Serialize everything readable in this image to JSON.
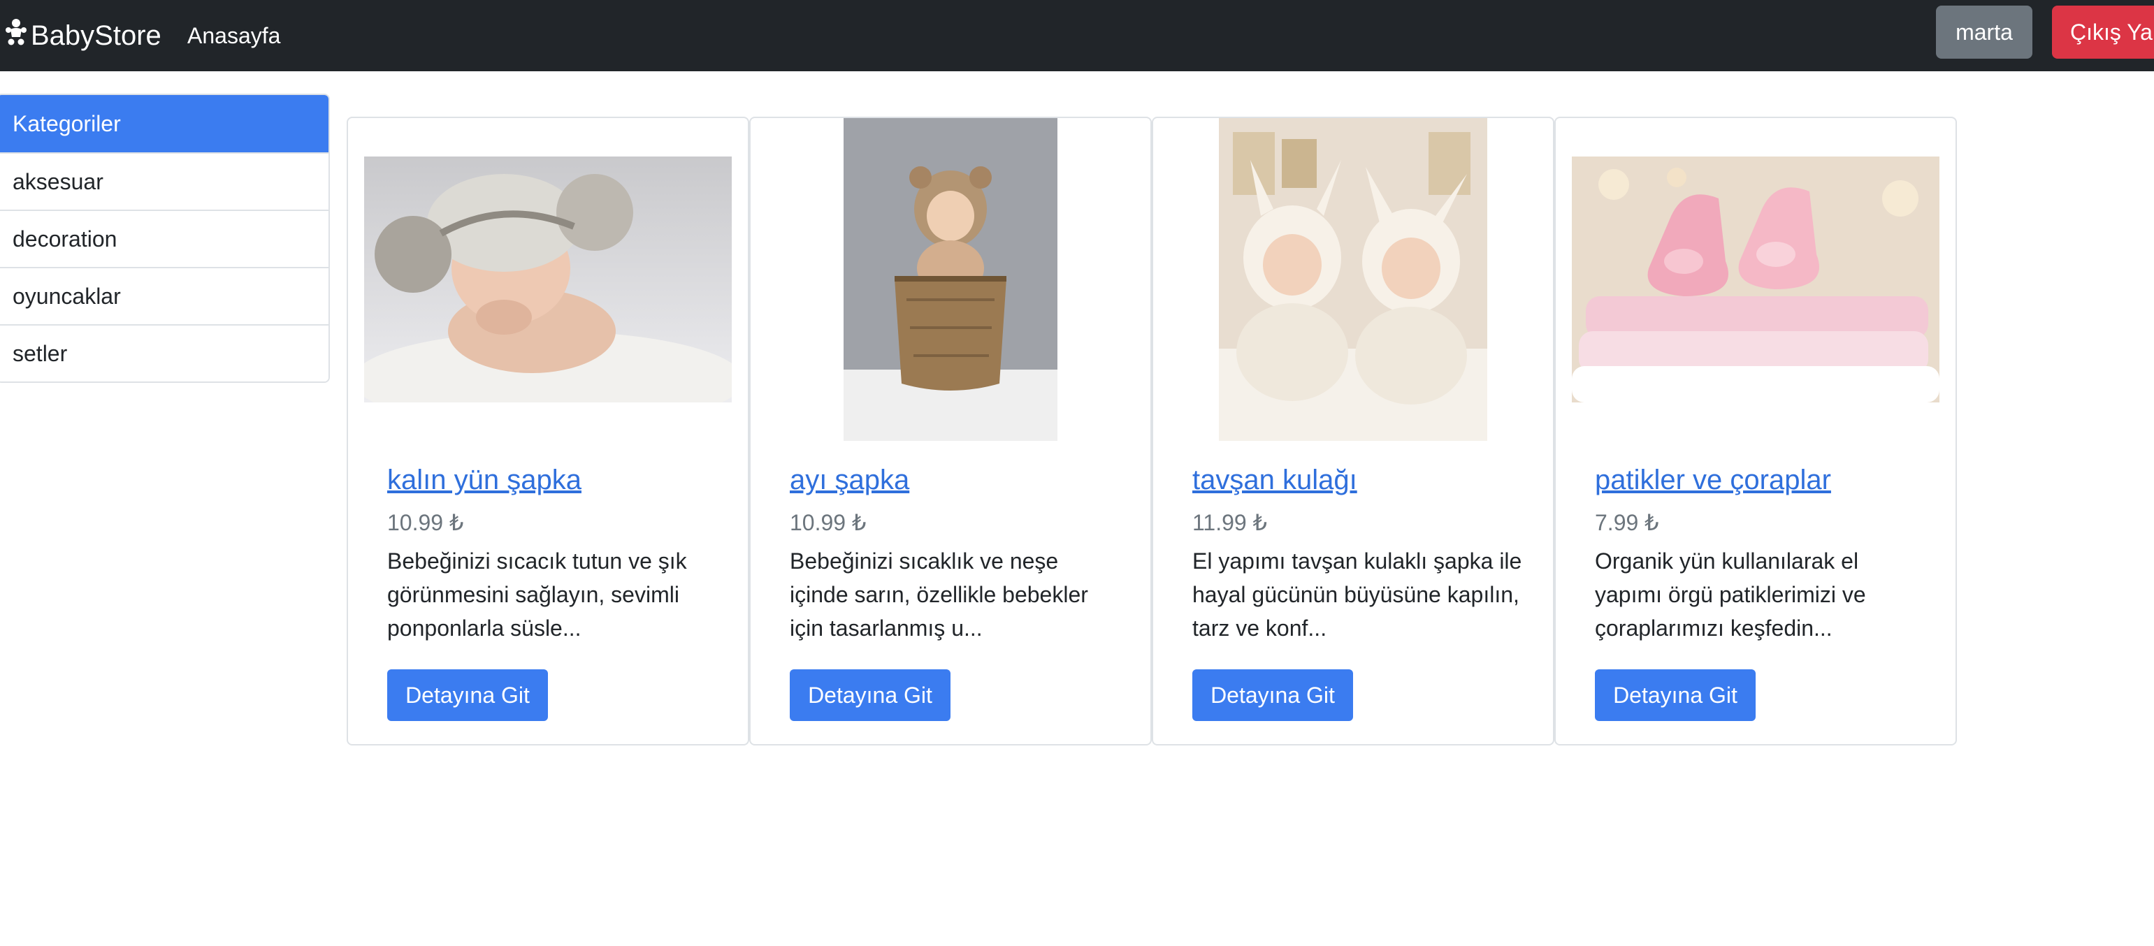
{
  "navbar": {
    "brand": "BabyStore",
    "brand_icon": "baby-icon",
    "home_link": "Anasayfa",
    "user_button": "marta",
    "logout_button": "Çıkış Yap"
  },
  "sidebar": {
    "header": "Kategoriler",
    "items": [
      {
        "label": "aksesuar"
      },
      {
        "label": "decoration"
      },
      {
        "label": "oyuncaklar"
      },
      {
        "label": "setler"
      }
    ]
  },
  "products": [
    {
      "title": "kalın yün şapka",
      "price": "10.99 ₺",
      "description": "Bebeğinizi sıcacık tutun ve şık görünmesini sağlayın, sevimli ponponlarla süsle...",
      "button": "Detayına Git"
    },
    {
      "title": "ayı şapka",
      "price": "10.99 ₺",
      "description": "Bebeğinizi sıcaklık ve neşe içinde sarın, özellikle bebekler için tasarlanmış u...",
      "button": "Detayına Git"
    },
    {
      "title": "tavşan kulağı",
      "price": "11.99 ₺",
      "description": "El yapımı tavşan kulaklı şapka ile hayal gücünün büyüsüne kapılın, tarz ve konf...",
      "button": "Detayına Git"
    },
    {
      "title": "patikler ve çoraplar",
      "price": "7.99 ₺",
      "description": "Organik yün kullanılarak el yapımı örgü patiklerimizi ve çoraplarımızı keşfedin...",
      "button": "Detayına Git"
    }
  ],
  "colors": {
    "navbar": "#212529",
    "primary": "#3b7cf0",
    "danger": "#dc3545",
    "secondary": "#6c757d"
  }
}
